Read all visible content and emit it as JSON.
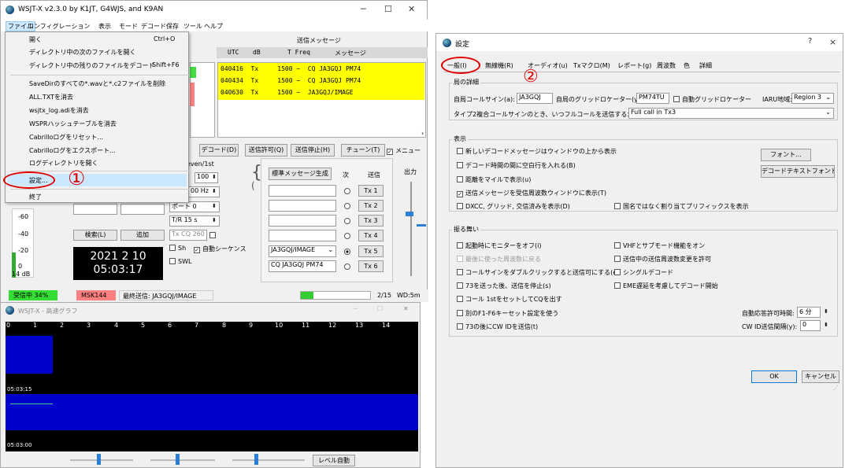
{
  "main": {
    "title": "WSJT-X  v2.3.0  by K1JT, G4WJS, and K9AN",
    "menubar": [
      "ファイル",
      "コンフィグレーション",
      "表示",
      "モード",
      "デコード",
      "保存",
      "ツール",
      "ヘルプ"
    ],
    "file_menu": [
      {
        "label": "開く",
        "shortcut": "Ctrl+O"
      },
      {
        "label": "ディレクトリ中の次のファイルを開く",
        "shortcut": ""
      },
      {
        "label": "ディレクトリ中の残りのファイルをデコード",
        "shortcut": "Shift+F6"
      },
      {
        "label": "SaveDirのすべての*.wavと*.c2ファイルを削除",
        "shortcut": ""
      },
      {
        "label": "ALL.TXTを消去",
        "shortcut": ""
      },
      {
        "label": "wsjtx_log.adiを消去",
        "shortcut": ""
      },
      {
        "label": "WSPRハッシュテーブルを消去",
        "shortcut": ""
      },
      {
        "label": "Cabrilloログをリセット...",
        "shortcut": ""
      },
      {
        "label": "Cabrilloログをエクスポート...",
        "shortcut": ""
      },
      {
        "label": "ログディレクトリを開く",
        "shortcut": ""
      },
      {
        "label": "設定...",
        "shortcut": ""
      },
      {
        "label": "終了",
        "shortcut": ""
      }
    ],
    "step1": "①",
    "tx_header": "送信メッセージ",
    "cols": [
      "UTC",
      "dB",
      "T Freq",
      "メッセージ"
    ],
    "tx_rows": [
      "040416  Tx     1500 ~  CQ JA3GQJ PM74",
      "040434  Tx     1500 ~  CQ JA3GQJ PM74",
      "040630  Tx     1500 ~  JA3GQJ/IMAGE"
    ],
    "green_label": "3",
    "buttons": {
      "decode": "デコード(D)",
      "enable_tx": "送信許可(Q)",
      "halt_tx": "送信停止(H)",
      "tune": "チューン(T)",
      "menus": "メニュー",
      "search": "検索(L)",
      "add": "追加",
      "gen_std": "標準メッセージ生成",
      "auto_level": "レベル自動"
    },
    "even_label": "even/1st",
    "spin": {
      "a": "100",
      "b": "00 Hz",
      "c": "ポート 0",
      "d": "T/R 15 s",
      "e": "Tx CQ 260"
    },
    "next_label": "次",
    "send_label": "送信",
    "output_label": "出力",
    "tx_fields": [
      "",
      "",
      "",
      "",
      "JA3GQJ/IMAGE",
      "CQ JA3GQJ PM74"
    ],
    "tx_buttons": [
      "Tx 1",
      "Tx 2",
      "Tx 3",
      "Tx 4",
      "Tx 5",
      "Tx 6"
    ],
    "sh_label": "Sh",
    "auto_seq_label": "自動シーケンス",
    "swl_label": "SWL",
    "meter_ticks": [
      "-60",
      "-40",
      "-20",
      "0"
    ],
    "db_label": "14 dB",
    "date": "2021 2 10",
    "time": "05:03:17",
    "status": {
      "rx": "受信中  34%",
      "mode": "MSK144",
      "last_tx": "最終送信: JA3GQJ/IMAGE",
      "progress": "2/15",
      "wd": "WD:5m"
    }
  },
  "graph": {
    "title": "WSJT-X - 高速グラフ",
    "ticks": [
      "0",
      "1",
      "2",
      "3",
      "4",
      "5",
      "6",
      "7",
      "8",
      "9",
      "10",
      "11",
      "12",
      "13",
      "14"
    ],
    "time1": "05:03:15",
    "time2": "05:03:00"
  },
  "settings": {
    "title": "設定",
    "help": "?",
    "close": "×",
    "tabs": [
      "一般(I)",
      "無線機(R)",
      "オーディオ(u)",
      "Txマクロ(M)",
      "レポート(g)",
      "周波数",
      "色",
      "詳細"
    ],
    "step2": "②",
    "station_group": "局の詳細",
    "callsign_label": "自局コールサイン(a):",
    "callsign": "JA3GQJ",
    "grid_label": "自局のグリッドロケーター(y):",
    "grid": "PM74TU",
    "autogrid": "自動グリッドロケーター",
    "iaru_label": "IARU地域:",
    "iaru": "Region 3",
    "type2_label": "タイプ2複合コールサインのとき、いつフルコールを送信するか:",
    "type2": "Full call in Tx3",
    "display_group": "表示",
    "display_opts": [
      {
        "label": "新しいデコードメッセージはウィンドウの上から表示",
        "checked": false
      },
      {
        "label": "デコード時間の間に空白行を入れる(B)",
        "checked": false
      },
      {
        "label": "距離をマイルで表示(u)",
        "checked": false
      },
      {
        "label": "送信メッセージを受信周波数ウィンドウに表示(T)",
        "checked": true
      },
      {
        "label": "DXCC, グリッド, 交信済みを表示(D)",
        "checked": false
      }
    ],
    "prefix_opt": "国名ではなく割り当てプリフィックスを表示",
    "font_btn": "フォント...",
    "decode_font_btn": "デコードテキストフォント...",
    "behavior_group": "振る舞い",
    "behavior_left": [
      {
        "label": "起動時にモニターをオフ(i)",
        "checked": false,
        "disabled": false
      },
      {
        "label": "最後に使った周波数に戻る",
        "checked": false,
        "disabled": true
      },
      {
        "label": "コールサインをダブルクリックすると送信可にする(e)",
        "checked": false,
        "disabled": false
      },
      {
        "label": "73を送った後、送信を停止(s)",
        "checked": false,
        "disabled": false
      },
      {
        "label": "コール 1stをセットしてCQを出す",
        "checked": false,
        "disabled": false
      },
      {
        "label": "別のF1-F6キーセット設定を使う",
        "checked": false,
        "disabled": false
      },
      {
        "label": "73の後にCW IDを送信(t)",
        "checked": false,
        "disabled": false
      }
    ],
    "behavior_right": [
      "VHFとサブモード機能をオン",
      "送信中の送信周波数変更を許可",
      "シングルデコード",
      "EME遅延を考慮してデコード開始"
    ],
    "watchdog_label": "自動応答許可時間:",
    "watchdog": "6 分",
    "cwid_label": "CW ID送信間隔(y):",
    "cwid": "0",
    "ok": "OK",
    "cancel": "キャンセル"
  },
  "colors": {
    "yellow": "#ffff00",
    "menu_hl": "#cce8ff",
    "red": "#e00000",
    "green": "#33cc33",
    "blue": "#0000cc",
    "navy": "#000080"
  }
}
